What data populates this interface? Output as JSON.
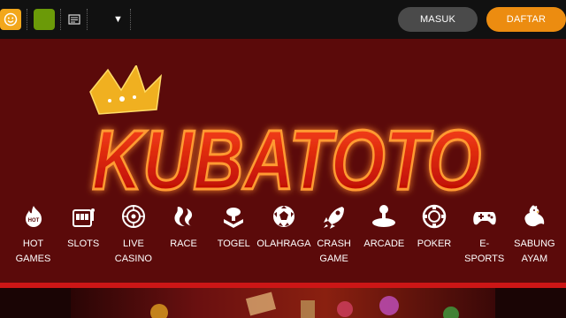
{
  "header": {
    "login_label": "MASUK",
    "register_label": "DAFTAR"
  },
  "brand": {
    "name": "KUBATOTO"
  },
  "nav": [
    {
      "label": "HOT\nGAMES",
      "icon": "hot-fire-icon"
    },
    {
      "label": "SLOTS",
      "icon": "slot-machine-icon"
    },
    {
      "label": "LIVE\nCASINO",
      "icon": "roulette-icon"
    },
    {
      "label": "RACE",
      "icon": "race-icon"
    },
    {
      "label": "TOGEL",
      "icon": "lottery-icon"
    },
    {
      "label": "OLAHRAGA",
      "icon": "soccer-ball-icon"
    },
    {
      "label": "CRASH\nGAME",
      "icon": "rocket-icon"
    },
    {
      "label": "ARCADE",
      "icon": "joystick-icon"
    },
    {
      "label": "POKER",
      "icon": "poker-chip-icon"
    },
    {
      "label": "E-SPORTS",
      "icon": "gamepad-icon"
    },
    {
      "label": "SABUNG\nAYAM",
      "icon": "rooster-icon"
    }
  ],
  "colors": {
    "topbar": "#111111",
    "hero_bg": "#5b0a0a",
    "login_bg": "#4a4a4a",
    "register_bg": "#ec8c10",
    "accent_red": "#cc1616"
  }
}
